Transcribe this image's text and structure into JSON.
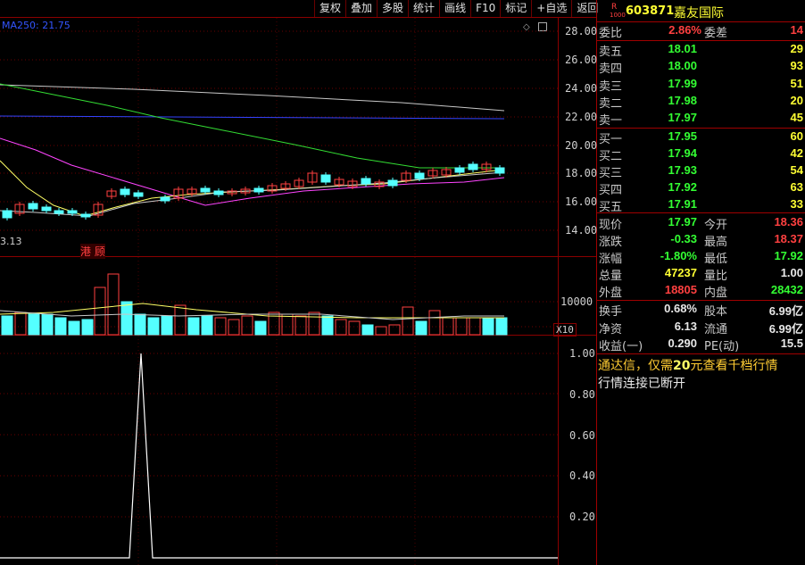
{
  "toolbar": [
    "复权",
    "叠加",
    "多股",
    "统计",
    "画线",
    "F10",
    "标记",
    "+自选",
    "返回"
  ],
  "main_chart": {
    "ma_label": "MA250: 21.75",
    "price_ticks": [
      "28.00",
      "26.00",
      "24.00",
      "22.00",
      "20.00",
      "18.00",
      "16.00",
      "14.00"
    ],
    "low_label": "3.13",
    "event_label": "港 顾",
    "volume_tick": "10000",
    "volume_unit": "X10",
    "indicator_ticks": [
      "1.00",
      "0.80",
      "0.60",
      "0.40",
      "0.20"
    ]
  },
  "quote": {
    "badge": "R",
    "badge_sub": "1000",
    "code": "603871",
    "name": "嘉友国际",
    "ratio_label": "委比",
    "ratio_value": "2.86%",
    "diff_label": "委差",
    "diff_value": "14",
    "asks": [
      {
        "label": "卖五",
        "price": "18.01",
        "vol": "29"
      },
      {
        "label": "卖四",
        "price": "18.00",
        "vol": "93"
      },
      {
        "label": "卖三",
        "price": "17.99",
        "vol": "51"
      },
      {
        "label": "卖二",
        "price": "17.98",
        "vol": "20"
      },
      {
        "label": "卖一",
        "price": "17.97",
        "vol": "45"
      }
    ],
    "bids": [
      {
        "label": "买一",
        "price": "17.95",
        "vol": "60"
      },
      {
        "label": "买二",
        "price": "17.94",
        "vol": "42"
      },
      {
        "label": "买三",
        "price": "17.93",
        "vol": "54"
      },
      {
        "label": "买四",
        "price": "17.92",
        "vol": "63"
      },
      {
        "label": "买五",
        "price": "17.91",
        "vol": "33"
      }
    ],
    "stats": [
      {
        "l1": "现价",
        "v1": "17.97",
        "c1": "green",
        "l2": "今开",
        "v2": "18.36",
        "c2": "red"
      },
      {
        "l1": "涨跌",
        "v1": "-0.33",
        "c1": "green",
        "l2": "最高",
        "v2": "18.37",
        "c2": "red"
      },
      {
        "l1": "涨幅",
        "v1": "-1.80%",
        "c1": "green",
        "l2": "最低",
        "v2": "17.92",
        "c2": "green"
      },
      {
        "l1": "总量",
        "v1": "47237",
        "c1": "yellow",
        "l2": "量比",
        "v2": "1.00",
        "c2": "white"
      },
      {
        "l1": "外盘",
        "v1": "18805",
        "c1": "red",
        "l2": "内盘",
        "v2": "28432",
        "c2": "green"
      }
    ],
    "stats2": [
      {
        "l1": "换手",
        "v1": "0.68%",
        "l2": "股本",
        "v2": "6.99亿"
      },
      {
        "l1": "净资",
        "v1": "6.13",
        "l2": "流通",
        "v2": "6.99亿"
      },
      {
        "l1": "收益(一)",
        "v1": "0.290",
        "l2": "PE(动)",
        "v2": "15.5"
      }
    ],
    "notice_prefix": "通达信，仅需",
    "notice_number": "20",
    "notice_suffix": "元查看千档行情",
    "status": "行情连接已断开"
  },
  "colors": {
    "up": "#ff4040",
    "down": "#54ffff",
    "ma_white": "#c8c8c8",
    "ma_yellow": "#ffff66",
    "ma_magenta": "#ff44ff",
    "ma_green": "#33dd33",
    "ma_blue": "#3344ff"
  }
}
